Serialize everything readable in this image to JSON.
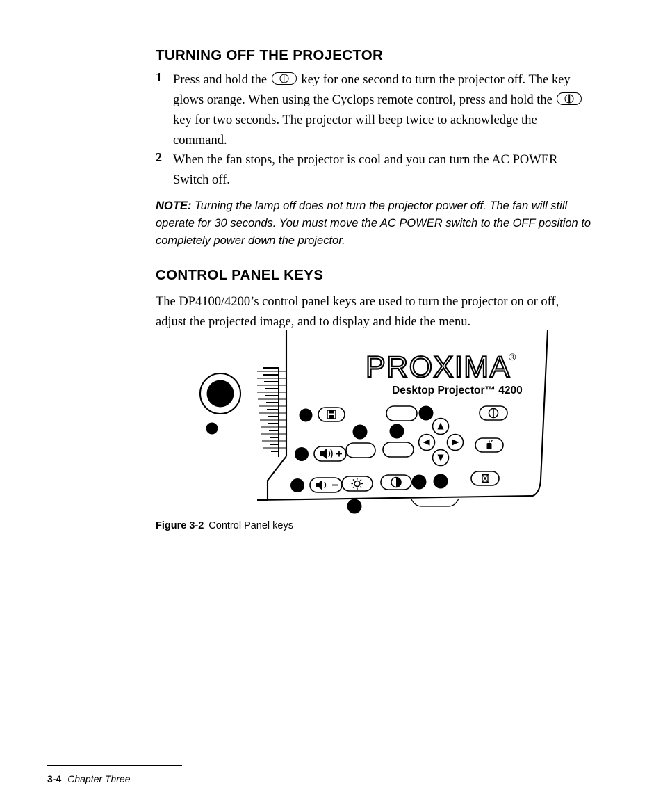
{
  "document": {
    "sections": [
      {
        "id": "turning-off",
        "heading": "TURNING OFF THE PROJECTOR"
      },
      {
        "id": "control-panel",
        "heading": "CONTROL PANEL KEYS"
      }
    ]
  },
  "steps": [
    {
      "number": "1",
      "part_a": "Press and hold the",
      "part_b": "key for one second to turn the projector off. The key glows orange. When using the Cyclops remote control, press and hold the",
      "part_c": "key for two seconds. The projector will beep twice to acknowledge the command."
    },
    {
      "number": "2",
      "text": "When the fan stops, the projector is cool and you can turn the AC POWER Switch off."
    }
  ],
  "note": {
    "label": "NOTE:",
    "text": "Turning the lamp off does not turn the projector power off. The fan will still operate for 30 seconds. You must move the AC POWER switch to the OFF position to completely power down the projector."
  },
  "control_panel_paragraph": "The DP4100/4200’s control panel keys are used to turn the projector on or off, adjust the projected image, and to display and hide the menu.",
  "figure": {
    "caption_label": "Figure 3-2",
    "caption_text": "Control Panel keys",
    "brand": "PROXIMA",
    "brand_mark": "®",
    "model_line": "Desktop Projector™ 4200",
    "keys": [
      {
        "name": "source-key",
        "icon": "floppy-disk-icon",
        "label": ""
      },
      {
        "name": "volume-up-key",
        "icon": "speaker-plus-icon",
        "label": ""
      },
      {
        "name": "volume-down-key",
        "icon": "speaker-minus-icon",
        "label": ""
      },
      {
        "name": "menu-key",
        "icon": "blank-icon",
        "label": ""
      },
      {
        "name": "select-key",
        "icon": "blank-icon",
        "label": ""
      },
      {
        "name": "brightness-key",
        "icon": "sun-icon",
        "label": ""
      },
      {
        "name": "contrast-key",
        "icon": "half-circle-icon",
        "label": ""
      },
      {
        "name": "exit-key",
        "icon": "blank-icon",
        "label": ""
      },
      {
        "name": "enter-key",
        "icon": "blank-icon",
        "label": ""
      },
      {
        "name": "arrow-up-key",
        "icon": "arrow-up-icon",
        "label": ""
      },
      {
        "name": "arrow-down-key",
        "icon": "arrow-down-icon",
        "label": ""
      },
      {
        "name": "arrow-left-key",
        "icon": "arrow-left-icon",
        "label": ""
      },
      {
        "name": "arrow-right-key",
        "icon": "arrow-right-icon",
        "label": ""
      },
      {
        "name": "power-key",
        "icon": "power-icon",
        "label": ""
      },
      {
        "name": "lamp-key",
        "icon": "lamp-icon",
        "label": ""
      },
      {
        "name": "mute-key",
        "icon": "crossed-out-icon",
        "label": ""
      }
    ]
  },
  "footer": {
    "page_number": "3-4",
    "chapter": "Chapter Three"
  },
  "colors": {
    "ink": "#000000",
    "paper": "#ffffff"
  }
}
